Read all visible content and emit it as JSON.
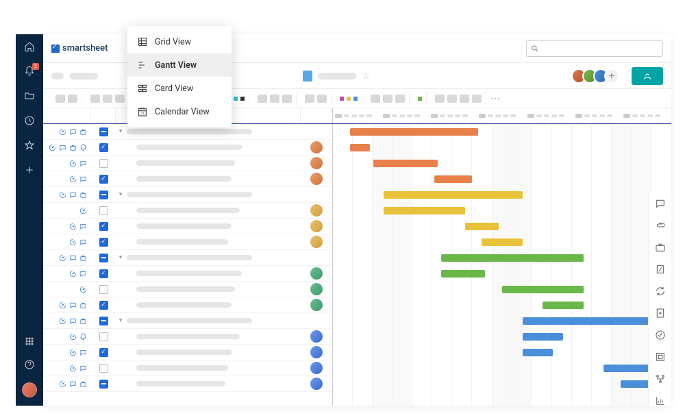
{
  "brand": {
    "name": "smartsheet"
  },
  "nav_rail": {
    "items": [
      "home",
      "notifications",
      "folders",
      "recents",
      "favorites",
      "add"
    ],
    "badge_count": "2"
  },
  "view_menu": {
    "items": [
      {
        "id": "grid",
        "label": "Grid View"
      },
      {
        "id": "gantt",
        "label": "Gantt View"
      },
      {
        "id": "card",
        "label": "Card View"
      },
      {
        "id": "calendar",
        "label": "Calendar View"
      }
    ],
    "active": "gantt"
  },
  "right_rail": [
    "conversations",
    "attachments",
    "briefcase",
    "proofs",
    "refresh",
    "add-file",
    "activity",
    "publish",
    "workflow",
    "chart"
  ],
  "colors": {
    "orange": "#e8804a",
    "yellow": "#e8c23a",
    "green": "#6ab84a",
    "blue": "#4a8fd9"
  },
  "gantt": {
    "columns": 17,
    "col_width_pct": 5.9,
    "weekend_cols": [
      2,
      3,
      8,
      9,
      14,
      15
    ]
  },
  "rows": [
    {
      "icons": [
        "attach",
        "comment",
        "lock"
      ],
      "check": "minus",
      "expand": true,
      "indent": 0,
      "task_w": 72,
      "avatar": null,
      "bar": {
        "color": "orange",
        "start": 5,
        "span": 38
      }
    },
    {
      "icons": [
        "attach",
        "comment",
        "lock",
        "reminder"
      ],
      "check": "checked",
      "expand": false,
      "indent": 1,
      "task_w": 64,
      "avatar": "rav-1",
      "bar": {
        "color": "orange",
        "start": 5,
        "span": 6
      }
    },
    {
      "icons": [
        "attach",
        "comment"
      ],
      "check": "empty",
      "expand": false,
      "indent": 1,
      "task_w": 60,
      "avatar": "rav-1",
      "bar": {
        "color": "orange",
        "start": 12,
        "span": 19
      }
    },
    {
      "icons": [
        "attach",
        "comment"
      ],
      "check": "checked",
      "expand": false,
      "indent": 1,
      "task_w": 58,
      "avatar": "rav-1",
      "bar": {
        "color": "orange",
        "start": 30,
        "span": 11
      }
    },
    {
      "icons": [
        "attach",
        "comment",
        "lock"
      ],
      "check": "minus",
      "expand": true,
      "indent": 0,
      "task_w": 72,
      "avatar": null,
      "bar": {
        "color": "yellow",
        "start": 15,
        "span": 41
      }
    },
    {
      "icons": [
        "attach"
      ],
      "check": "empty",
      "expand": false,
      "indent": 1,
      "task_w": 63,
      "avatar": "rav-2",
      "bar": {
        "color": "yellow",
        "start": 15,
        "span": 24
      }
    },
    {
      "icons": [
        "attach",
        "comment"
      ],
      "check": "checked",
      "expand": false,
      "indent": 1,
      "task_w": 58,
      "avatar": "rav-2",
      "bar": {
        "color": "yellow",
        "start": 39,
        "span": 10
      }
    },
    {
      "icons": [
        "attach",
        "comment"
      ],
      "check": "checked",
      "expand": false,
      "indent": 1,
      "task_w": 56,
      "avatar": "rav-2",
      "bar": {
        "color": "yellow",
        "start": 44,
        "span": 12
      }
    },
    {
      "icons": [
        "attach",
        "comment",
        "lock"
      ],
      "check": "minus",
      "expand": true,
      "indent": 0,
      "task_w": 72,
      "avatar": null,
      "bar": {
        "color": "green",
        "start": 32,
        "span": 42
      }
    },
    {
      "icons": [
        "attach",
        "comment"
      ],
      "check": "checked",
      "expand": false,
      "indent": 1,
      "task_w": 64,
      "avatar": "rav-3",
      "bar": {
        "color": "green",
        "start": 32,
        "span": 13
      }
    },
    {
      "icons": [
        "attach"
      ],
      "check": "empty",
      "expand": false,
      "indent": 1,
      "task_w": 60,
      "avatar": "rav-3",
      "bar": {
        "color": "green",
        "start": 50,
        "span": 24
      }
    },
    {
      "icons": [
        "attach",
        "comment",
        "lock"
      ],
      "check": "checked",
      "expand": false,
      "indent": 1,
      "task_w": 58,
      "avatar": "rav-3",
      "bar": {
        "color": "green",
        "start": 62,
        "span": 12
      }
    },
    {
      "icons": [
        "attach",
        "comment",
        "lock"
      ],
      "check": "minus",
      "expand": true,
      "indent": 0,
      "task_w": 72,
      "avatar": null,
      "bar": {
        "color": "blue",
        "start": 56,
        "span": 38
      }
    },
    {
      "icons": [
        "attach",
        "reminder"
      ],
      "check": "empty",
      "expand": false,
      "indent": 1,
      "task_w": 63,
      "avatar": "rav-4",
      "bar": {
        "color": "blue",
        "start": 56,
        "span": 12
      }
    },
    {
      "icons": [
        "attach",
        "comment"
      ],
      "check": "checked",
      "expand": false,
      "indent": 1,
      "task_w": 58,
      "avatar": "rav-4",
      "bar": {
        "color": "blue",
        "start": 56,
        "span": 9
      }
    },
    {
      "icons": [
        "attach",
        "comment"
      ],
      "check": "empty",
      "expand": false,
      "indent": 1,
      "task_w": 56,
      "avatar": "rav-4",
      "bar": {
        "color": "blue",
        "start": 80,
        "span": 14
      }
    },
    {
      "icons": [
        "attach",
        "comment",
        "lock"
      ],
      "check": "minus",
      "expand": false,
      "indent": 1,
      "task_w": 54,
      "avatar": "rav-4",
      "bar": {
        "color": "blue",
        "start": 85,
        "span": 9
      }
    }
  ]
}
